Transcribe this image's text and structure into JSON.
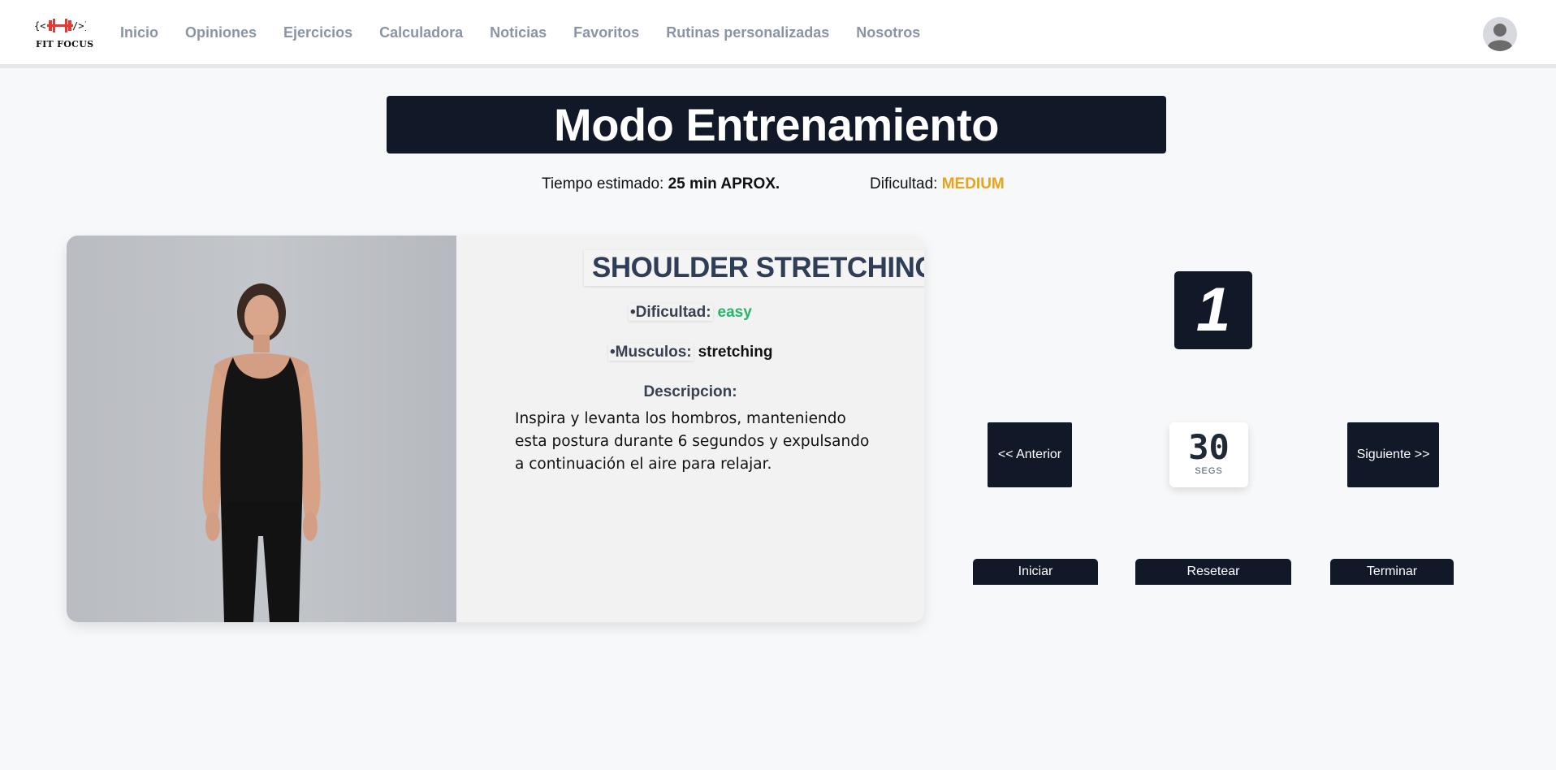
{
  "brand": {
    "logo_text": "FIT FOCUS"
  },
  "nav": {
    "items": [
      {
        "label": "Inicio"
      },
      {
        "label": "Opiniones"
      },
      {
        "label": "Ejercicios"
      },
      {
        "label": "Calculadora"
      },
      {
        "label": "Noticias"
      },
      {
        "label": "Favoritos"
      },
      {
        "label": "Rutinas personalizadas"
      },
      {
        "label": "Nosotros"
      }
    ],
    "avatar_icon": "user-avatar-icon"
  },
  "page": {
    "title": "Modo Entrenamiento",
    "time_label": "Tiempo estimado:",
    "time_value": "25 min APROX.",
    "difficulty_label": "Dificultad:",
    "difficulty_value": "MEDIUM"
  },
  "exercise": {
    "name": "SHOULDER STRETCHING",
    "difficulty_label": "•Dificultad:",
    "difficulty_value": "easy",
    "muscles_label": "•Musculos:",
    "muscles_value": "stretching",
    "description_label": "Descripcion:",
    "description": "Inspira y levanta los hombros, manteniendo esta postura durante 6 segundos y expulsando a continuación el aire para relajar."
  },
  "controls": {
    "counter": "1",
    "prev_label": "<< Anterior",
    "next_label": "Siguiente >>",
    "timer_value": "30",
    "timer_unit": "SEGS",
    "start_label": "Iniciar",
    "reset_label": "Resetear",
    "finish_label": "Terminar"
  },
  "colors": {
    "primary_dark": "#111827",
    "medium": "#e8a31b",
    "easy": "#22b866",
    "nav_text": "#8a94a6"
  }
}
